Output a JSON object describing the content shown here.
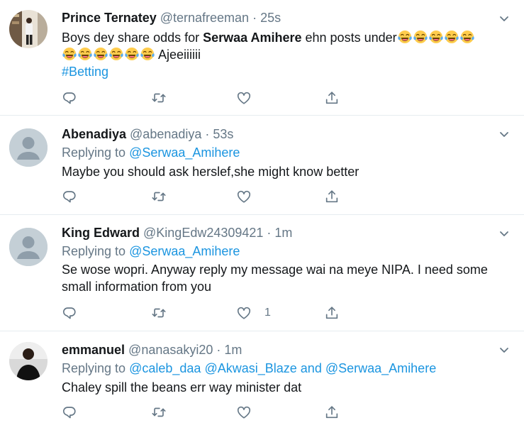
{
  "colors": {
    "link": "#1b95e0",
    "secondary": "#657786",
    "text": "#14171a",
    "divider": "#e6ecf0"
  },
  "icons": {
    "reply": "reply-icon",
    "retweet": "retweet-icon",
    "like": "heart-icon",
    "share": "share-icon",
    "menu": "chevron-down-icon",
    "emoji": "tears-of-joy-emoji"
  },
  "tweets": [
    {
      "name": "Prince Ternatey",
      "handle": "@ternafreeman",
      "sep": "·",
      "time": "25s",
      "body_pre": "Boys dey share odds for ",
      "body_bold": "Serwaa Amihere",
      "body_post": " ehn posts under",
      "body_after_emoji": " Ajeeiiiiii",
      "hashtag": "#Betting",
      "emoji_count_line1": 5,
      "emoji_count_line2": 6
    },
    {
      "name": "Abenadiya",
      "handle": "@abenadiya",
      "sep": "·",
      "time": "53s",
      "replying_label": "Replying to",
      "mentions": "@Serwaa_Amihere",
      "body": "Maybe you should ask herslef,she might know better"
    },
    {
      "name": "King Edward",
      "handle": "@KingEdw24309421",
      "sep": "·",
      "time": "1m",
      "replying_label": "Replying to",
      "mentions": "@Serwaa_Amihere",
      "body_line1": "Se wose wopri. Anyway reply my message wai na meye NIPA. I need some",
      "body_line2": "small information from you",
      "like_count": "1"
    },
    {
      "name": "emmanuel",
      "handle": "@nanasakyi20",
      "sep": "·",
      "time": "1m",
      "replying_label": "Replying to",
      "mention1": "@caleb_daa",
      "mention2": "@Akwasi_Blaze",
      "and": "and",
      "mention3": "@Serwaa_Amihere",
      "body": "Chaley spill the beans err way minister dat"
    }
  ]
}
